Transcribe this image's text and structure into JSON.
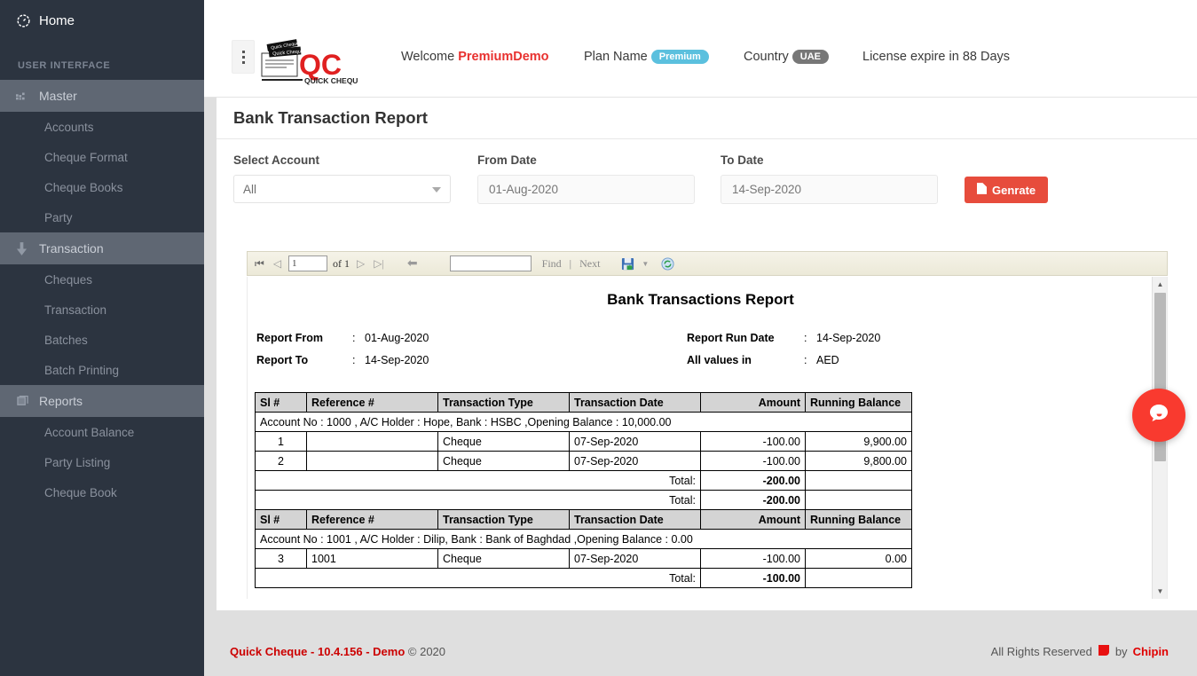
{
  "sidebar": {
    "home_label": "Home",
    "section_heading": "USER INTERFACE",
    "groups": [
      {
        "label": "Master",
        "icon": "grid-icon",
        "items": [
          {
            "label": "Accounts"
          },
          {
            "label": "Cheque Format"
          },
          {
            "label": "Cheque Books"
          },
          {
            "label": "Party"
          }
        ]
      },
      {
        "label": "Transaction",
        "icon": "arrow-down-icon",
        "items": [
          {
            "label": "Cheques"
          },
          {
            "label": "Transaction"
          },
          {
            "label": "Batches"
          },
          {
            "label": "Batch Printing"
          }
        ]
      },
      {
        "label": "Reports",
        "icon": "book-icon",
        "items": [
          {
            "label": "Account Balance"
          },
          {
            "label": "Party Listing"
          },
          {
            "label": "Cheque Book"
          }
        ]
      }
    ]
  },
  "topbar": {
    "logo_alt": "QC QUICK CHEQUE",
    "welcome_prefix": "Welcome ",
    "welcome_user": "PremiumDemo",
    "plan_label": "Plan Name",
    "plan_value": "Premium",
    "country_label": "Country",
    "country_value": "UAE",
    "license_text": "License expire in 88 Days"
  },
  "page": {
    "title": "Bank Transaction Report"
  },
  "filters": {
    "account_label": "Select Account",
    "account_value": "All",
    "from_label": "From Date",
    "from_value": "01-Aug-2020",
    "to_label": "To Date",
    "to_value": "14-Sep-2020",
    "generate_label": "Genrate"
  },
  "viewer": {
    "page_number": "1",
    "of_text": "of 1",
    "find_value": "",
    "find_label": "Find",
    "separator": "|",
    "next_label": "Next"
  },
  "report": {
    "title": "Bank Transactions Report",
    "meta": [
      {
        "label": "Report From",
        "colon": ":",
        "value": "01-Aug-2020"
      },
      {
        "label": "Report To",
        "colon": ":",
        "value": "14-Sep-2020"
      },
      {
        "label": "Report Run Date",
        "colon": ":",
        "value": "14-Sep-2020"
      },
      {
        "label": "All values in",
        "colon": ":",
        "value": "AED"
      }
    ],
    "columns": [
      "Sl #",
      "Reference #",
      "Transaction Type",
      "Transaction Date",
      "Amount",
      "Running Balance"
    ],
    "total_label": "Total:",
    "sections": [
      {
        "group": "Account No : 1000 , A/C Holder : Hope, Bank : HSBC ,Opening Balance : 10,000.00",
        "rows": [
          {
            "sl": "1",
            "ref": "",
            "type": "Cheque",
            "date": "07-Sep-2020",
            "amount": "-100.00",
            "balance": "9,900.00"
          },
          {
            "sl": "2",
            "ref": "",
            "type": "Cheque",
            "date": "07-Sep-2020",
            "amount": "-100.00",
            "balance": "9,800.00"
          }
        ],
        "totals": [
          "-200.00",
          "-200.00"
        ]
      },
      {
        "group": "Account No : 1001 , A/C Holder : Dilip, Bank : Bank of Baghdad ,Opening Balance : 0.00",
        "rows": [
          {
            "sl": "3",
            "ref": "1001",
            "type": "Cheque",
            "date": "07-Sep-2020",
            "amount": "-100.00",
            "balance": "0.00"
          }
        ],
        "totals": [
          "-100.00"
        ]
      }
    ]
  },
  "footer": {
    "product": "Quick Cheque",
    "sep1": " - ",
    "version": "10.4.156",
    "sep2": " - ",
    "edition": "Demo",
    "copyright": "© 2020",
    "rights": "All Rights Reserved",
    "by": "by",
    "brand": "Chipin"
  },
  "colors": {
    "accent_red": "#e74c3c",
    "sidebar_bg": "#2c3440",
    "green": "#00b96b",
    "blue_pill": "#5bc0de"
  }
}
